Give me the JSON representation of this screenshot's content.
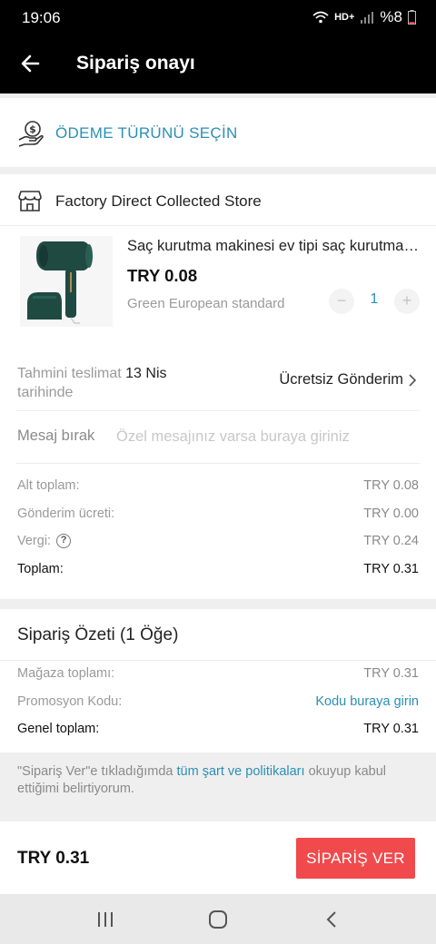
{
  "status": {
    "time": "19:06",
    "network": "HD+",
    "battery": "%8"
  },
  "header": {
    "title": "Sipariş onayı"
  },
  "payment": {
    "label": "ÖDEME TÜRÜNÜ SEÇİN"
  },
  "store": {
    "name": "Factory Direct Collected Store"
  },
  "product": {
    "title": "Saç kurutma makinesi ev tipi saç kurutma makinesi",
    "price": "TRY 0.08",
    "variant": "Green European standard",
    "quantity": "1",
    "minus": "−",
    "plus": "+"
  },
  "delivery": {
    "label_pre": "Tahmini teslimat",
    "date": "13 Nis",
    "label_post": "tarihinde",
    "shipping": "Ücretsiz Gönderim"
  },
  "message": {
    "label": "Mesaj bırak",
    "placeholder": "Özel mesajınız varsa buraya giriniz"
  },
  "totals": {
    "subtotal_label": "Alt toplam:",
    "subtotal": "TRY 0.08",
    "shipping_label": "Gönderim ücreti:",
    "shipping": "TRY 0.00",
    "tax_label": "Vergi:",
    "tax": "TRY 0.24",
    "total_label": "Toplam:",
    "total": "TRY 0.31"
  },
  "summary": {
    "title": "Sipariş Özeti (1 Öğe)",
    "store_total_label": "Mağaza toplamı:",
    "store_total": "TRY 0.31",
    "promo_label": "Promosyon Kodu:",
    "promo_link": "Kodu buraya girin",
    "grand_total_label": "Genel toplam:",
    "grand_total": "TRY 0.31"
  },
  "terms": {
    "pre": "\"Sipariş Ver\"e tıkladığımda ",
    "link": "tüm şart ve politikaları",
    "post": " okuyup kabul ettiğimi belirtiyorum."
  },
  "bottom": {
    "total": "TRY 0.31",
    "button": "SİPARİŞ VER"
  },
  "colors": {
    "accent": "#2a8fb5",
    "order_button": "#f04a4c",
    "header": "#000000"
  },
  "icons": [
    "back-arrow-icon",
    "payment-hand-icon",
    "store-icon",
    "help-icon",
    "chevron-right-icon",
    "recent-apps-icon",
    "home-icon",
    "back-nav-icon"
  ]
}
